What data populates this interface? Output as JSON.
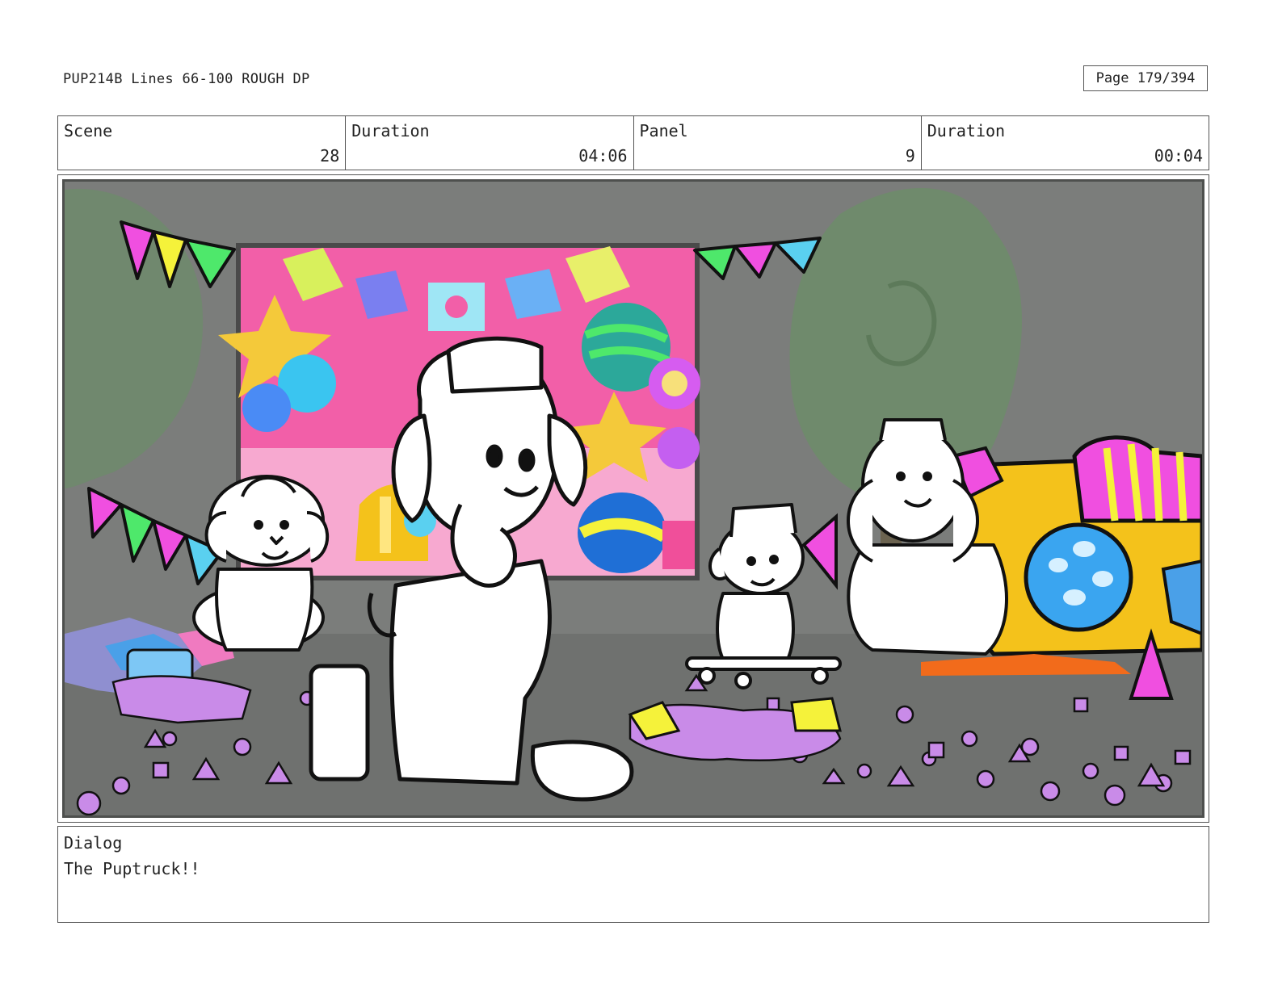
{
  "header": {
    "title": "PUP214B Lines 66-100 ROUGH DP",
    "page": "Page 179/394"
  },
  "info": {
    "scene_label": "Scene",
    "scene_value": "28",
    "duration_label": "Duration",
    "duration_value": "04:06",
    "panel_label": "Panel",
    "panel_value": "9",
    "panel_duration_label": "Duration",
    "panel_duration_value": "00:04"
  },
  "dialog": {
    "label": "Dialog",
    "text": "The Puptruck!!"
  },
  "colors": {
    "background_gray": "#7b7d7b",
    "floor_gray": "#6f716f",
    "tree_green": "#6f8a6c",
    "banner_pink": "#f25fa8",
    "confetti_purple": "#c98be8",
    "truck_yellow": "#f4c21b",
    "flag_magenta": "#f04fe0",
    "flag_yellow": "#f5f23a",
    "flag_green": "#4ee86b",
    "flag_cyan": "#5ad0f0"
  }
}
